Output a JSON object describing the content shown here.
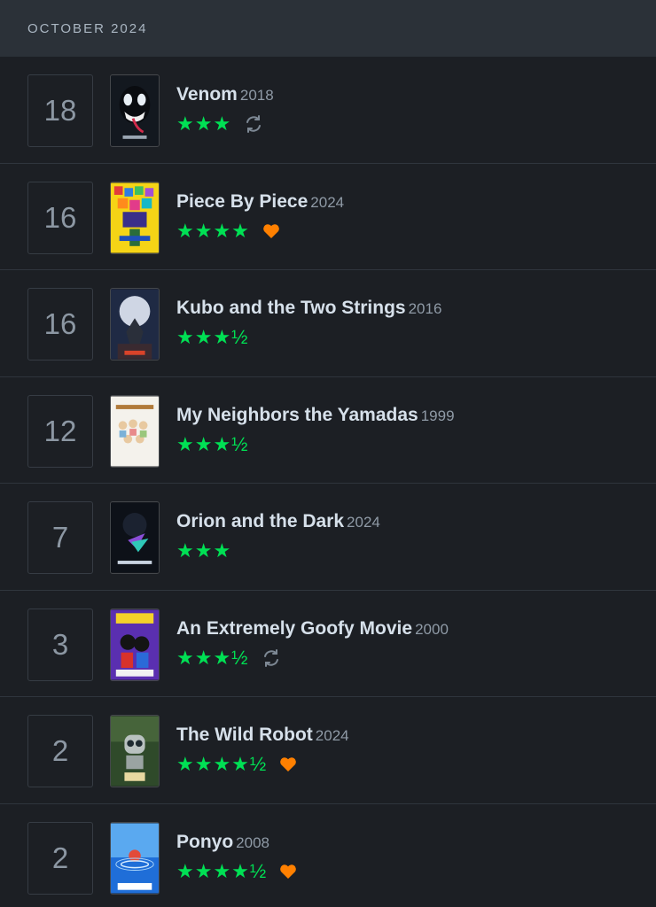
{
  "header": {
    "month": "OCTOBER 2024"
  },
  "colors": {
    "star": "#00e054",
    "heart": "#ff8000",
    "rewatch": "#7d8894"
  },
  "entries": [
    {
      "day": "18",
      "title": "Venom",
      "year": "2018",
      "rating": "★★★",
      "liked": false,
      "rewatch": true,
      "poster_icon": "venom-poster"
    },
    {
      "day": "16",
      "title": "Piece By Piece",
      "year": "2024",
      "rating": "★★★★",
      "liked": true,
      "rewatch": false,
      "poster_icon": "piece-by-piece-poster"
    },
    {
      "day": "16",
      "title": "Kubo and the Two Strings",
      "year": "2016",
      "rating": "★★★½",
      "liked": false,
      "rewatch": false,
      "poster_icon": "kubo-poster"
    },
    {
      "day": "12",
      "title": "My Neighbors the Yamadas",
      "year": "1999",
      "rating": "★★★½",
      "liked": false,
      "rewatch": false,
      "poster_icon": "yamadas-poster"
    },
    {
      "day": "7",
      "title": "Orion and the Dark",
      "year": "2024",
      "rating": "★★★",
      "liked": false,
      "rewatch": false,
      "poster_icon": "orion-poster"
    },
    {
      "day": "3",
      "title": "An Extremely Goofy Movie",
      "year": "2000",
      "rating": "★★★½",
      "liked": false,
      "rewatch": true,
      "poster_icon": "goofy-poster"
    },
    {
      "day": "2",
      "title": "The Wild Robot",
      "year": "2024",
      "rating": "★★★★½",
      "liked": true,
      "rewatch": false,
      "poster_icon": "wild-robot-poster"
    },
    {
      "day": "2",
      "title": "Ponyo",
      "year": "2008",
      "rating": "★★★★½",
      "liked": true,
      "rewatch": false,
      "poster_icon": "ponyo-poster"
    }
  ]
}
